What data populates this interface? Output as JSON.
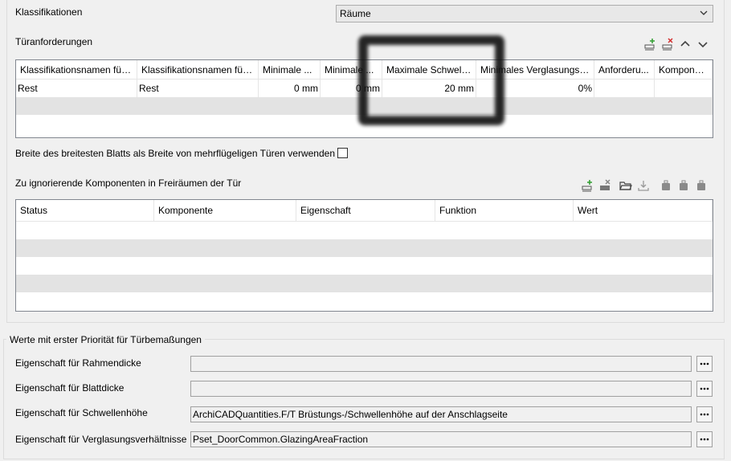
{
  "classification": {
    "label": "Klassifikationen",
    "dropdown_value": "Räume"
  },
  "door_requirements": {
    "title": "Türanforderungen",
    "columns": [
      "Klassifikationsnamen für ...",
      "Klassifikationsnamen für ...",
      "Minimale ...",
      "Minimale ...",
      "Maximale Schwell...",
      "Minimales Verglasungsv...",
      "Anforderu...",
      "Kompone..."
    ],
    "rows": [
      [
        "Rest",
        "Rest",
        "0 mm",
        "0 mm",
        "20 mm",
        "0%",
        "",
        ""
      ]
    ]
  },
  "checkbox": {
    "label": "Breite des breitesten Blatts als Breite von mehrflügeligen Türen verwenden",
    "checked": false
  },
  "ignored_components": {
    "title": "Zu ignorierende Komponenten in Freiräumen der Tür",
    "columns": [
      "Status",
      "Komponente",
      "Eigenschaft",
      "Funktion",
      "Wert"
    ]
  },
  "priority_values": {
    "title": "Werte mit erster Priorität für Türbemaßungen",
    "fields": [
      {
        "label": "Eigenschaft für Rahmendicke",
        "value": ""
      },
      {
        "label": "Eigenschaft für Blattdicke",
        "value": ""
      },
      {
        "label": "Eigenschaft für Schwellenhöhe",
        "value": "ArchiCADQuantities.F/T Brüstungs-/Schwellenhöhe auf der Anschlagseite"
      },
      {
        "label": "Eigenschaft für Verglasungsverhältnisse",
        "value": "Pset_DoorCommon.GlazingAreaFraction"
      }
    ],
    "button_label": "..."
  },
  "colors": {
    "background": "#f0f0f0",
    "grid_alt_row": "#e3e3e3",
    "add_icon": "#2e9e2e",
    "delete_icon": "#d32f2f"
  },
  "icons": [
    "add-row-icon",
    "delete-row-icon",
    "move-up-icon",
    "move-down-icon",
    "folder-open-icon",
    "download-icon",
    "package-icon",
    "dropdown-chevron-icon",
    "ellipsis-icon"
  ]
}
